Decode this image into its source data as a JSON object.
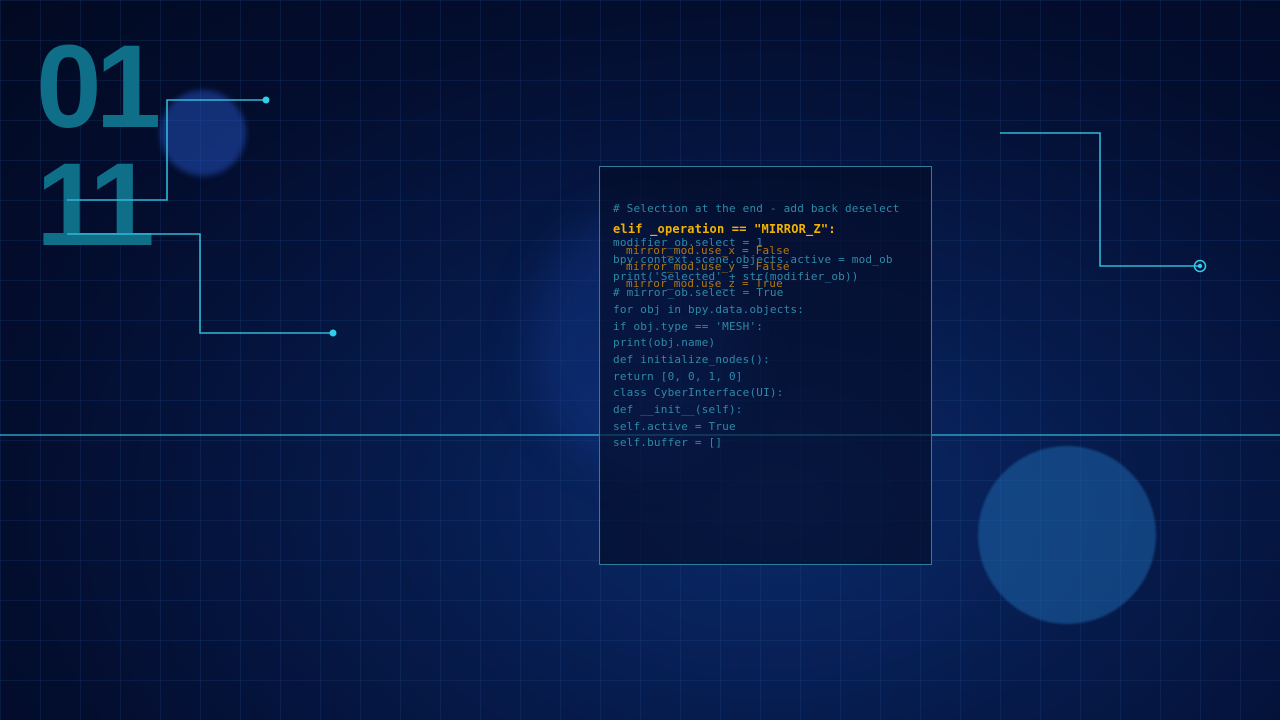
{
  "binary": {
    "line1": "01",
    "line2": "11"
  },
  "code": {
    "lines": [
      "# Selection at the end - add back deselect",
      "modifier_ob.select = 1",
      "bpy.context.scene.objects.active = mod_ob",
      "print('Selected' + str(modifier_ob))",
      "# mirror_ob.select = True",
      "for obj in bpy.data.objects:",
      "if obj.type == 'MESH':",
      "print(obj.name)",
      "def initialize_nodes():",
      "return [0, 0, 1, 0]",
      "class CyberInterface(UI):",
      "def __init__(self):",
      "self.active = True",
      "self.buffer = []"
    ],
    "highlight": "elif _operation == \"MIRROR_Z\":",
    "overlay": [
      "mirror_mod.use_x = False",
      "mirror_mod.use_y = False",
      "mirror_mod.use_z = True"
    ]
  },
  "colors": {
    "accent": "#2fc6e0",
    "highlight": "#f2b400",
    "digits": "#0f6e88",
    "background": "#030d2e"
  }
}
